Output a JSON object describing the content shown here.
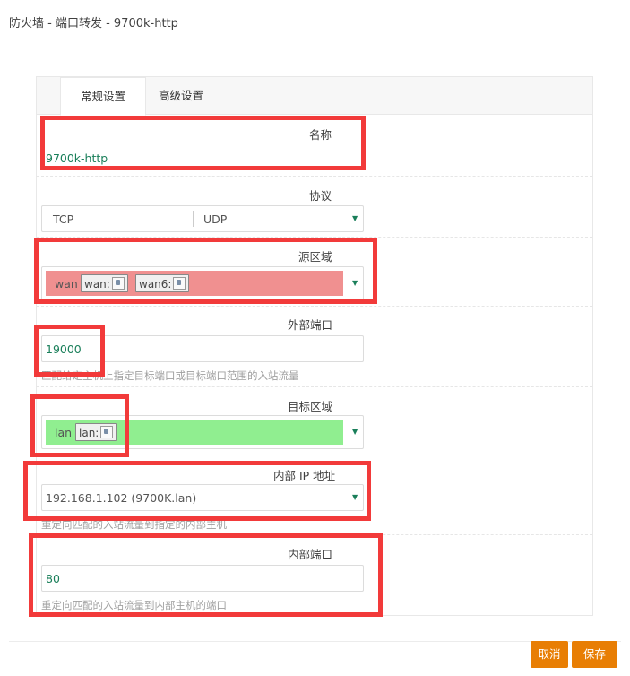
{
  "dialog": {
    "title": "防火墙 - 端口转发 - 9700k-http"
  },
  "tabs": [
    {
      "label": "常规设置",
      "active": true
    },
    {
      "label": "高级设置",
      "active": false
    }
  ],
  "fields": {
    "name": {
      "label": "名称",
      "value": "9700k-http"
    },
    "protocol": {
      "label": "协议",
      "options": [
        "TCP",
        "UDP"
      ]
    },
    "source_zone": {
      "label": "源区域",
      "zone": "wan",
      "networks": [
        "wan:",
        "wan6:"
      ],
      "color": "#f09090"
    },
    "external_port": {
      "label": "外部端口",
      "value": "19000",
      "hint": "匹配给定主机上指定目标端口或目标端口范围的入站流量"
    },
    "dest_zone": {
      "label": "目标区域",
      "zone": "lan",
      "networks": [
        "lan:"
      ],
      "color": "#90ee90"
    },
    "internal_ip": {
      "label": "内部 IP 地址",
      "value": "192.168.1.102 (9700K.lan)",
      "hint": "重定向匹配的入站流量到指定的内部主机"
    },
    "internal_port": {
      "label": "内部端口",
      "value": "80",
      "hint": "重定向匹配的入站流量到内部主机的端口"
    }
  },
  "footer": {
    "cancel_label": "取消",
    "save_label": "保存"
  },
  "colors": {
    "accent": "#e87e04",
    "value_text": "#1a7f5a",
    "annotation": "#f23a3a"
  },
  "icons": [
    "network-port-icon",
    "dropdown-caret-icon"
  ]
}
